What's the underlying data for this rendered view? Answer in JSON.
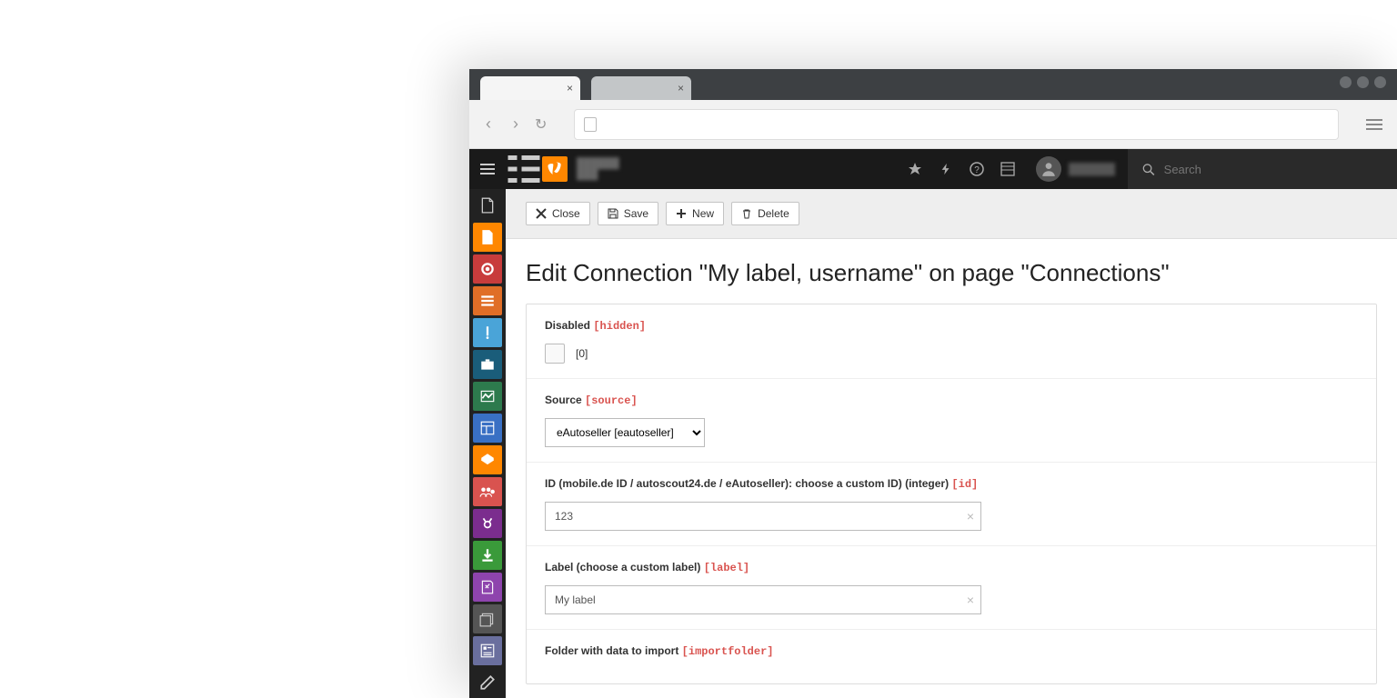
{
  "topbar": {
    "search_placeholder": "Search"
  },
  "toolbar": {
    "close": "Close",
    "save": "Save",
    "new": "New",
    "delete": "Delete"
  },
  "page_title": "Edit Connection \"My label, username\" on page \"Connections\"",
  "fields": {
    "disabled": {
      "label": "Disabled",
      "key": "[hidden]",
      "checkbox_label": "[0]"
    },
    "source": {
      "label": "Source",
      "key": "[source]",
      "value": "eAutoseller [eautoseller]"
    },
    "id": {
      "label": "ID (mobile.de ID / autoscout24.de / eAutoseller): choose a custom ID) (integer)",
      "key": "[id]",
      "value": "123"
    },
    "label_field": {
      "label": "Label (choose a custom label)",
      "key": "[label]",
      "value": "My label"
    },
    "importfolder": {
      "label": "Folder with data to import",
      "key": "[importfolder]"
    }
  },
  "module_menu_colors": [
    "transparent",
    "#ff8700",
    "#c83c3c",
    "#e06e27",
    "#4aa4d8",
    "#1a5d7a",
    "#2d7a4d",
    "#3970c4",
    "#ff8700",
    "#d9534f",
    "#7b2d8e",
    "#3a9a3a",
    "#8e44ad",
    "#555555",
    "#6a6f9e",
    "#4a4a4a"
  ]
}
